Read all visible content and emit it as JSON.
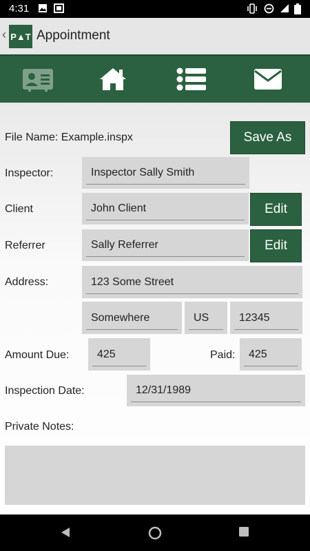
{
  "status_bar": {
    "time": "4:31"
  },
  "app_bar": {
    "back_glyph": "‹",
    "logo_text": "P▲T",
    "title": "Appointment"
  },
  "toolbar": {
    "items": [
      {
        "icon": "contact-card-icon"
      },
      {
        "icon": "home-icon"
      },
      {
        "icon": "list-icon"
      },
      {
        "icon": "mail-icon"
      }
    ]
  },
  "form": {
    "file_name_label": "File Name: Example.inspx",
    "save_as_label": "Save As",
    "inspector_label": "Inspector:",
    "inspector_value": "Inspector Sally Smith",
    "client_label": "Client",
    "client_value": "John Client",
    "client_edit_label": "Edit",
    "referrer_label": "Referrer",
    "referrer_value": "Sally Referrer",
    "referrer_edit_label": "Edit",
    "address_label": "Address:",
    "street_value": "123 Some Street",
    "city_value": "Somewhere",
    "country_value": "US",
    "zip_value": "12345",
    "amount_due_label": "Amount Due:",
    "amount_due_value": "425",
    "paid_label": "Paid:",
    "paid_value": "425",
    "inspection_date_label": "Inspection Date:",
    "inspection_date_value": "12/31/1989",
    "private_notes_label": "Private Notes:",
    "private_notes_value": ""
  },
  "colors": {
    "accent": "#2b6140",
    "field_bg": "#d6d6d6",
    "appbar_bg": "#e6e6e6"
  }
}
